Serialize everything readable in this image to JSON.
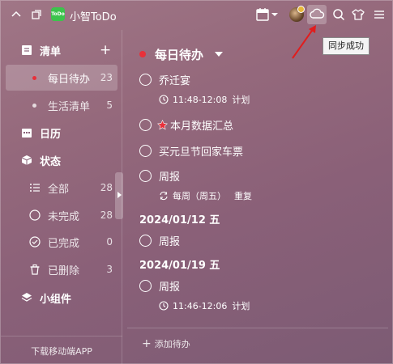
{
  "app": {
    "title": "小智ToDo",
    "logo_text": "ToDo"
  },
  "sidebar": {
    "lists_header": "清单",
    "lists": [
      {
        "label": "每日待办",
        "count": "23",
        "active": true
      },
      {
        "label": "生活清单",
        "count": "5",
        "active": false
      }
    ],
    "calendar_label": "日历",
    "status_header": "状态",
    "status_items": [
      {
        "label": "全部",
        "count": "28"
      },
      {
        "label": "未完成",
        "count": "28"
      },
      {
        "label": "已完成",
        "count": "0"
      },
      {
        "label": "已删除",
        "count": "3"
      }
    ],
    "widgets_label": "小组件",
    "download_label": "下载移动端APP"
  },
  "main": {
    "list_title": "每日待办",
    "tasks": [
      {
        "title": "乔迁宴",
        "time": "11:48-12:08",
        "tag": "计划"
      },
      {
        "title": "本月数据汇总"
      },
      {
        "title": "买元旦节回家车票"
      },
      {
        "title": "周报",
        "repeat": "每周（周五）",
        "tag": "重复"
      }
    ],
    "groups": [
      {
        "date": "2024/01/12 五",
        "tasks": [
          {
            "title": "周报"
          }
        ]
      },
      {
        "date": "2024/01/19 五",
        "tasks": [
          {
            "title": "周报",
            "time": "11:46-12:06",
            "tag": "计划"
          }
        ]
      }
    ],
    "add_task_label": "添加待办"
  },
  "tooltip": {
    "text": "同步成功"
  },
  "colors": {
    "accent_red": "#e8303a",
    "logo_green": "#3cc34c",
    "arrow_red": "#e11d1d"
  },
  "icons": [
    "chevron-up-icon",
    "pin-window-icon",
    "calendar-icon",
    "cloud-sync-icon",
    "search-icon",
    "skin-icon",
    "menu-icon",
    "plus-icon",
    "clock-icon",
    "repeat-icon",
    "star-icon"
  ]
}
